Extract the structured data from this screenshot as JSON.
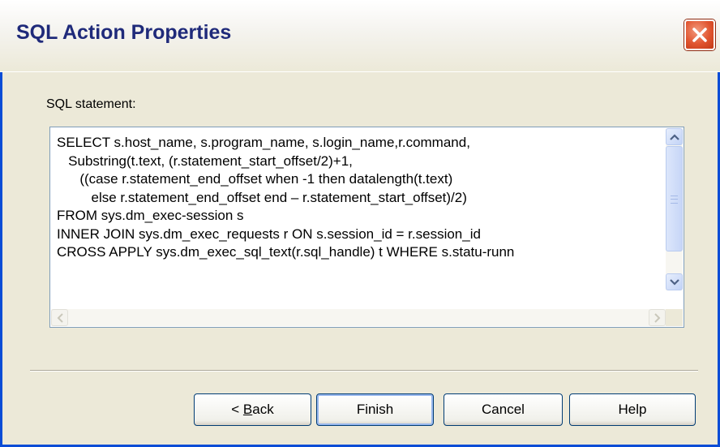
{
  "window": {
    "title": "SQL Action Properties"
  },
  "form": {
    "sql_label": "SQL statement:"
  },
  "editor": {
    "lines": [
      "SELECT s.host_name, s.program_name, s.login_name,r.command,",
      "   Substring(t.text, (r.statement_start_offset/2)+1,",
      "      ((case r.statement_end_offset when -1 then datalength(t.text)",
      "         else r.statement_end_offset end – r.statement_start_offset)/2)",
      "FROM sys.dm_exec-session s",
      "INNER JOIN sys.dm_exec_requests r ON s.session_id = r.session_id",
      "CROSS APPLY sys.dm_exec_sql_text(r.sql_handle) t WHERE s.statu-runn"
    ]
  },
  "buttons": {
    "back_prefix": "< ",
    "back_mnemonic": "B",
    "back_rest": "ack",
    "finish": "Finish",
    "cancel": "Cancel",
    "help": "Help"
  },
  "icons": {
    "close": "close-icon",
    "scroll_up": "arrow-up-icon",
    "scroll_down": "arrow-down-icon",
    "scroll_left": "arrow-left-icon",
    "scroll_right": "arrow-right-icon"
  },
  "colors": {
    "titlebar_text": "#1F2A7A",
    "close_button": "#E0542F",
    "dialog_bg": "#ECE9D8",
    "window_border": "#0A4CD6"
  }
}
